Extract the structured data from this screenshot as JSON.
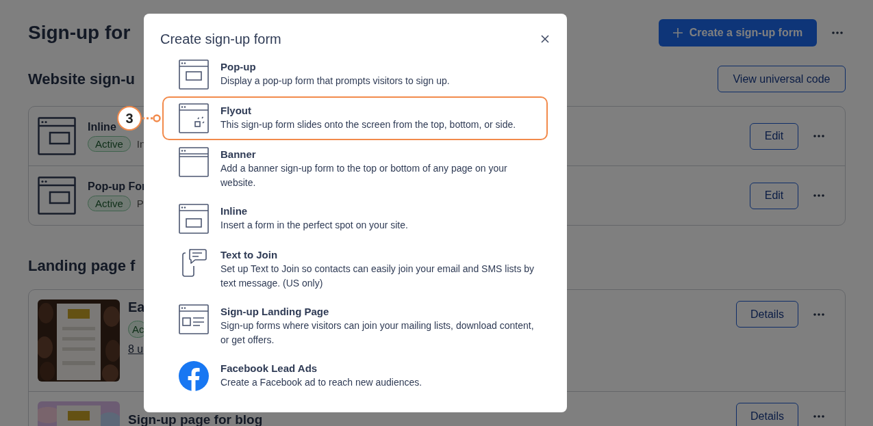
{
  "page": {
    "title": "Sign-up for",
    "create_button": "Create a sign-up form",
    "website_section": {
      "heading": "Website sign-u",
      "button": "View universal code",
      "forms": [
        {
          "name": "Inline",
          "status": "Active",
          "detail": "In",
          "action": "Edit"
        },
        {
          "name": "Pop-up For",
          "status": "Active",
          "detail": "P",
          "action": "Edit"
        }
      ]
    },
    "landing_section": {
      "heading": "Landing page f",
      "pages": [
        {
          "name": "Ea",
          "status": "Ac",
          "link": "8 u",
          "action": "Details"
        },
        {
          "name": "Sign-up page for blog",
          "action": "Details"
        }
      ]
    }
  },
  "dialog": {
    "title": "Create sign-up form",
    "options": [
      {
        "kind": "popup",
        "title": "Pop-up",
        "description": "Display a pop-up form that prompts visitors to sign up.",
        "highlighted": false
      },
      {
        "kind": "flyout",
        "title": "Flyout",
        "description": "This sign-up form slides onto the screen from the top, bottom, or side.",
        "highlighted": true
      },
      {
        "kind": "banner",
        "title": "Banner",
        "description": "Add a banner sign-up form to the top or bottom of any page on your website.",
        "highlighted": false
      },
      {
        "kind": "inline",
        "title": "Inline",
        "description": "Insert a form in the perfect spot on your site.",
        "highlighted": false
      },
      {
        "kind": "text",
        "title": "Text to Join",
        "description": "Set up Text to Join so contacts can easily join your email and SMS lists by text message. (US only)",
        "highlighted": false
      },
      {
        "kind": "landing",
        "title": "Sign-up Landing Page",
        "description": "Sign-up forms where visitors can join your mailing lists, download content, or get offers.",
        "highlighted": false
      },
      {
        "kind": "facebook",
        "title": "Facebook Lead Ads",
        "description": "Create a Facebook ad to reach new audiences.",
        "highlighted": false
      }
    ]
  },
  "annotation": {
    "step": "3"
  }
}
